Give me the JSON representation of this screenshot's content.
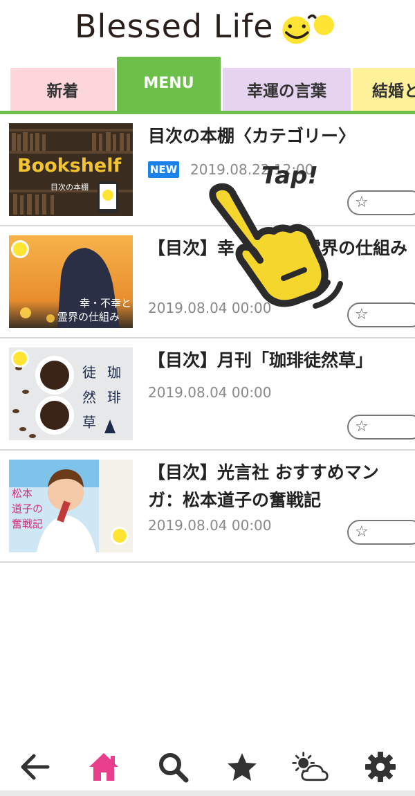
{
  "app": {
    "title": "Blessed Life"
  },
  "tabs": [
    {
      "label": "新着"
    },
    {
      "label": "MENU"
    },
    {
      "label": "幸運の言葉"
    },
    {
      "label": "結婚と"
    }
  ],
  "articles": [
    {
      "title": "目次の本棚〈カテゴリー〉",
      "badge": "NEW",
      "date": "2019.08.22 12:00",
      "thumb_text": "Bookshelf",
      "thumb_sub": "目次の本棚"
    },
    {
      "title": "【目次】幸・不幸と霊界の仕組み",
      "date": "2019.08.04 00:00",
      "thumb_text_1": "幸・不幸と",
      "thumb_text_2": "霊界の仕組み"
    },
    {
      "title": "【目次】月刊「珈琲徒然草」",
      "date": "2019.08.04 00:00",
      "thumb_text_1": "珈",
      "thumb_text_2": "琲",
      "thumb_text_3": "徒",
      "thumb_text_4": "然",
      "thumb_text_5": "草"
    },
    {
      "title": "【目次】光言社 おすすめマンガ：松本道子の奮戦記",
      "date": "2019.08.04 00:00",
      "thumb_text_1": "松本",
      "thumb_text_2": "道子の",
      "thumb_text_3": "奮戦記"
    }
  ],
  "overlay": {
    "tap_label": "Tap!"
  },
  "bottom_nav": {
    "icons": [
      "back-arrow-icon",
      "home-icon",
      "search-icon",
      "star-icon",
      "weather-icon",
      "gear-icon"
    ]
  },
  "colors": {
    "accent_green": "#6cc04a",
    "home_pink": "#e83e8c",
    "new_blue": "#1a82e8"
  }
}
